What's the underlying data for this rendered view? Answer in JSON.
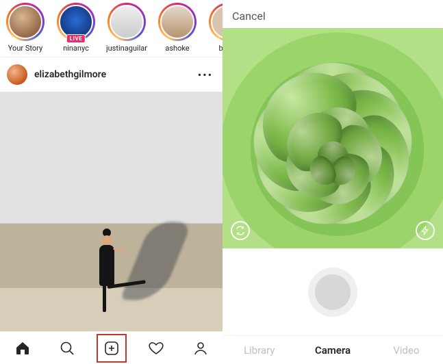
{
  "stories": [
    {
      "label": "Your Story",
      "badge": null
    },
    {
      "label": "ninanyc",
      "badge": "LIVE"
    },
    {
      "label": "justinaguilar",
      "badge": null
    },
    {
      "label": "ashoke",
      "badge": null
    },
    {
      "label": "benjir",
      "badge": null
    }
  ],
  "post": {
    "username": "elizabethgilmore",
    "more": "•••"
  },
  "nav": {
    "highlighted": "create"
  },
  "camera": {
    "cancel": "Cancel",
    "switch_icon": "switch-camera",
    "flash_icon": "flash",
    "modes": [
      {
        "key": "library",
        "label": "Library",
        "active": false
      },
      {
        "key": "camera",
        "label": "Camera",
        "active": true
      },
      {
        "key": "video",
        "label": "Video",
        "active": false
      }
    ]
  }
}
